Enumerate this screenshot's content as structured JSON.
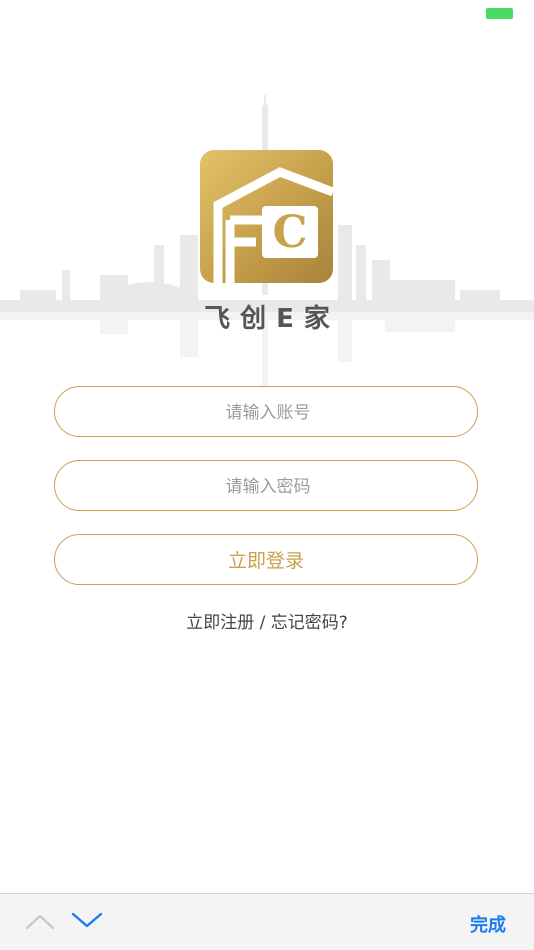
{
  "status_bar": {
    "battery_color": "#4cd964"
  },
  "brand": {
    "name": "飞创E家",
    "logo_letters": "FC",
    "accent_color": "#c9a24d"
  },
  "form": {
    "account": {
      "placeholder": "请输入账号",
      "value": ""
    },
    "password": {
      "placeholder": "请输入密码",
      "value": ""
    },
    "login_label": "立即登录"
  },
  "links": {
    "register": "立即注册",
    "separator": " / ",
    "forgot": "忘记密码?"
  },
  "keyboard_toolbar": {
    "prev_icon": "chevron-up-icon",
    "next_icon": "chevron-down-icon",
    "done_label": "完成",
    "done_color": "#1b7cf2"
  }
}
